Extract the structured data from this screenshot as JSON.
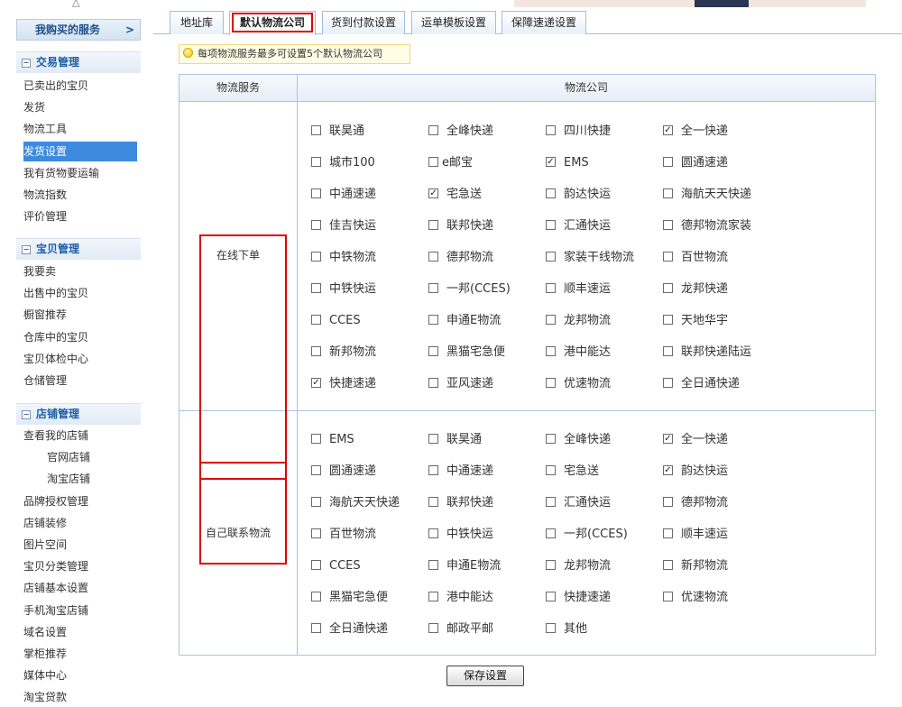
{
  "sidebar": {
    "service_label": "我购买的服务",
    "service_arrow": ">",
    "sections": [
      {
        "title": "交易管理",
        "toggle": "−",
        "items": [
          "已卖出的宝贝",
          "发货",
          "物流工具",
          "发货设置",
          "我有货物要运输",
          "物流指数",
          "评价管理"
        ]
      },
      {
        "title": "宝贝管理",
        "toggle": "−",
        "items": [
          "我要卖",
          "出售中的宝贝",
          "橱窗推荐",
          "仓库中的宝贝",
          "宝贝体检中心",
          "仓储管理"
        ]
      },
      {
        "title": "店铺管理",
        "toggle": "−",
        "items": [
          "查看我的店铺",
          "官网店铺",
          "淘宝店铺",
          "品牌授权管理",
          "店铺装修",
          "图片空间",
          "宝贝分类管理",
          "店铺基本设置",
          "手机淘宝店铺",
          "域名设置",
          "掌柜推荐",
          "媒体中心",
          "淘宝贷款"
        ]
      }
    ],
    "active_item": "发货设置"
  },
  "tabs": [
    "地址库",
    "默认物流公司",
    "货到付款设置",
    "运单模板设置",
    "保障速递设置"
  ],
  "active_tab": "默认物流公司",
  "tip": "每项物流服务最多可设置5个默认物流公司",
  "table": {
    "col_service": "物流服务",
    "col_company": "物流公司",
    "groups": [
      {
        "service": "在线下单",
        "options": [
          {
            "label": "联昊通",
            "checked": false
          },
          {
            "label": "全峰快递",
            "checked": false
          },
          {
            "label": "四川快捷",
            "checked": false
          },
          {
            "label": "全一快递",
            "checked": true
          },
          {
            "label": "城市100",
            "checked": false
          },
          {
            "label": "e邮宝",
            "checked": false
          },
          {
            "label": "EMS",
            "checked": true
          },
          {
            "label": "圆通速递",
            "checked": false
          },
          {
            "label": "中通速递",
            "checked": false
          },
          {
            "label": "宅急送",
            "checked": true
          },
          {
            "label": "韵达快运",
            "checked": false
          },
          {
            "label": "海航天天快递",
            "checked": false
          },
          {
            "label": "佳吉快运",
            "checked": false
          },
          {
            "label": "联邦快递",
            "checked": false
          },
          {
            "label": "汇通快运",
            "checked": false
          },
          {
            "label": "德邦物流家装",
            "checked": false
          },
          {
            "label": "中铁物流",
            "checked": false
          },
          {
            "label": "德邦物流",
            "checked": false
          },
          {
            "label": "家装干线物流",
            "checked": false
          },
          {
            "label": "百世物流",
            "checked": false
          },
          {
            "label": "中铁快运",
            "checked": false
          },
          {
            "label": "一邦(CCES)",
            "checked": false
          },
          {
            "label": "顺丰速运",
            "checked": false
          },
          {
            "label": "龙邦快递",
            "checked": false
          },
          {
            "label": "CCES",
            "checked": false
          },
          {
            "label": "申通E物流",
            "checked": false
          },
          {
            "label": "龙邦物流",
            "checked": false
          },
          {
            "label": "天地华宇",
            "checked": false
          },
          {
            "label": "新邦物流",
            "checked": false
          },
          {
            "label": "黑猫宅急便",
            "checked": false
          },
          {
            "label": "港中能达",
            "checked": false
          },
          {
            "label": "联邦快递陆运",
            "checked": false
          },
          {
            "label": "快捷速递",
            "checked": true
          },
          {
            "label": "亚风速递",
            "checked": false
          },
          {
            "label": "优速物流",
            "checked": false
          },
          {
            "label": "全日通快递",
            "checked": false
          }
        ]
      },
      {
        "service": "自己联系物流",
        "options": [
          {
            "label": "EMS",
            "checked": false
          },
          {
            "label": "联昊通",
            "checked": false
          },
          {
            "label": "全峰快递",
            "checked": false
          },
          {
            "label": "全一快递",
            "checked": true
          },
          {
            "label": "圆通速递",
            "checked": false
          },
          {
            "label": "中通速递",
            "checked": false
          },
          {
            "label": "宅急送",
            "checked": false
          },
          {
            "label": "韵达快运",
            "checked": true
          },
          {
            "label": "海航天天快递",
            "checked": false
          },
          {
            "label": "联邦快递",
            "checked": false
          },
          {
            "label": "汇通快运",
            "checked": false
          },
          {
            "label": "德邦物流",
            "checked": false
          },
          {
            "label": "百世物流",
            "checked": false
          },
          {
            "label": "中铁快运",
            "checked": false
          },
          {
            "label": "一邦(CCES)",
            "checked": false
          },
          {
            "label": "顺丰速运",
            "checked": false
          },
          {
            "label": "CCES",
            "checked": false
          },
          {
            "label": "申通E物流",
            "checked": false
          },
          {
            "label": "龙邦物流",
            "checked": false
          },
          {
            "label": "新邦物流",
            "checked": false
          },
          {
            "label": "黑猫宅急便",
            "checked": false
          },
          {
            "label": "港中能达",
            "checked": false
          },
          {
            "label": "快捷速递",
            "checked": false
          },
          {
            "label": "优速物流",
            "checked": false
          },
          {
            "label": "全日通快递",
            "checked": false
          },
          {
            "label": "邮政平邮",
            "checked": false
          },
          {
            "label": "其他",
            "checked": false
          }
        ]
      }
    ]
  },
  "save_label": "保存设置",
  "colors": {
    "link_blue": "#1d5ea7",
    "active_blue": "#3d8bdf",
    "border_blue": "#a9c4e2",
    "highlight_red": "#e00000"
  }
}
